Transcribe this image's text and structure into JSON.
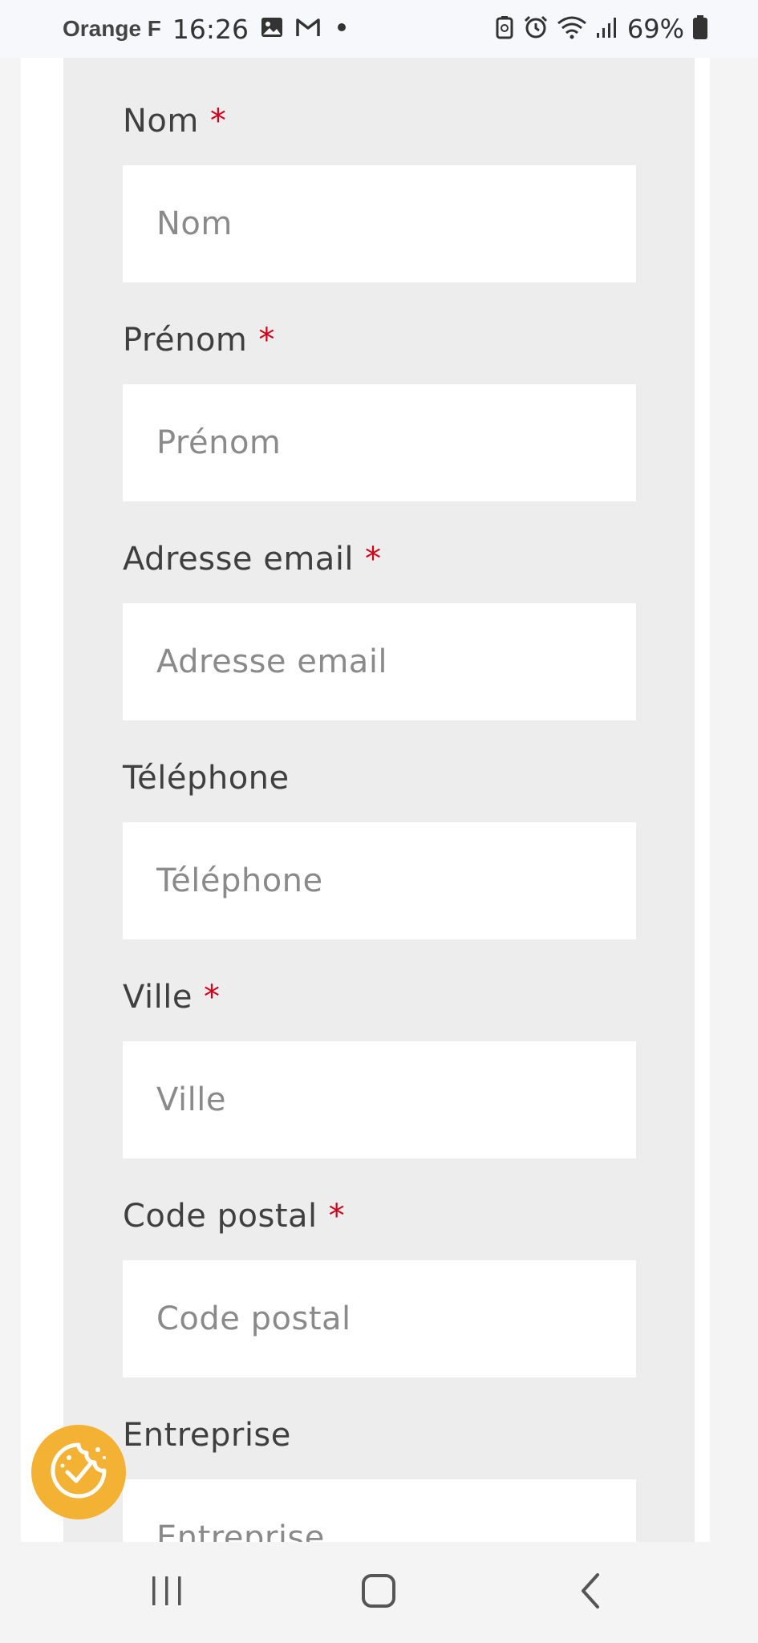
{
  "status_bar": {
    "carrier": "Orange F",
    "time": "16:26",
    "battery_percent": "69%",
    "icons_left": [
      "gallery-icon",
      "gmail-icon",
      "dot-icon"
    ],
    "icons_right": [
      "battery-saver-icon",
      "alarm-icon",
      "wifi-icon",
      "signal-icon",
      "battery-icon"
    ]
  },
  "form": {
    "fields": [
      {
        "label": "Nom",
        "required": "*",
        "placeholder": "Nom"
      },
      {
        "label": "Prénom",
        "required": "*",
        "placeholder": "Prénom"
      },
      {
        "label": "Adresse email",
        "required": "*",
        "placeholder": "Adresse email"
      },
      {
        "label": "Téléphone",
        "required": "",
        "placeholder": "Téléphone"
      },
      {
        "label": "Ville",
        "required": "*",
        "placeholder": "Ville"
      },
      {
        "label": "Code postal",
        "required": "*",
        "placeholder": "Code postal"
      },
      {
        "label": "Entreprise",
        "required": "",
        "placeholder": "Entreprise"
      }
    ]
  },
  "cookie_button": {
    "icon": "cookie-check-icon",
    "color": "#f3b233"
  },
  "nav_bar": {
    "icons": [
      "recent-apps-icon",
      "home-icon",
      "back-icon"
    ]
  },
  "colors": {
    "required": "#d0021b",
    "panel": "#ededed",
    "accent": "#f3b233"
  }
}
